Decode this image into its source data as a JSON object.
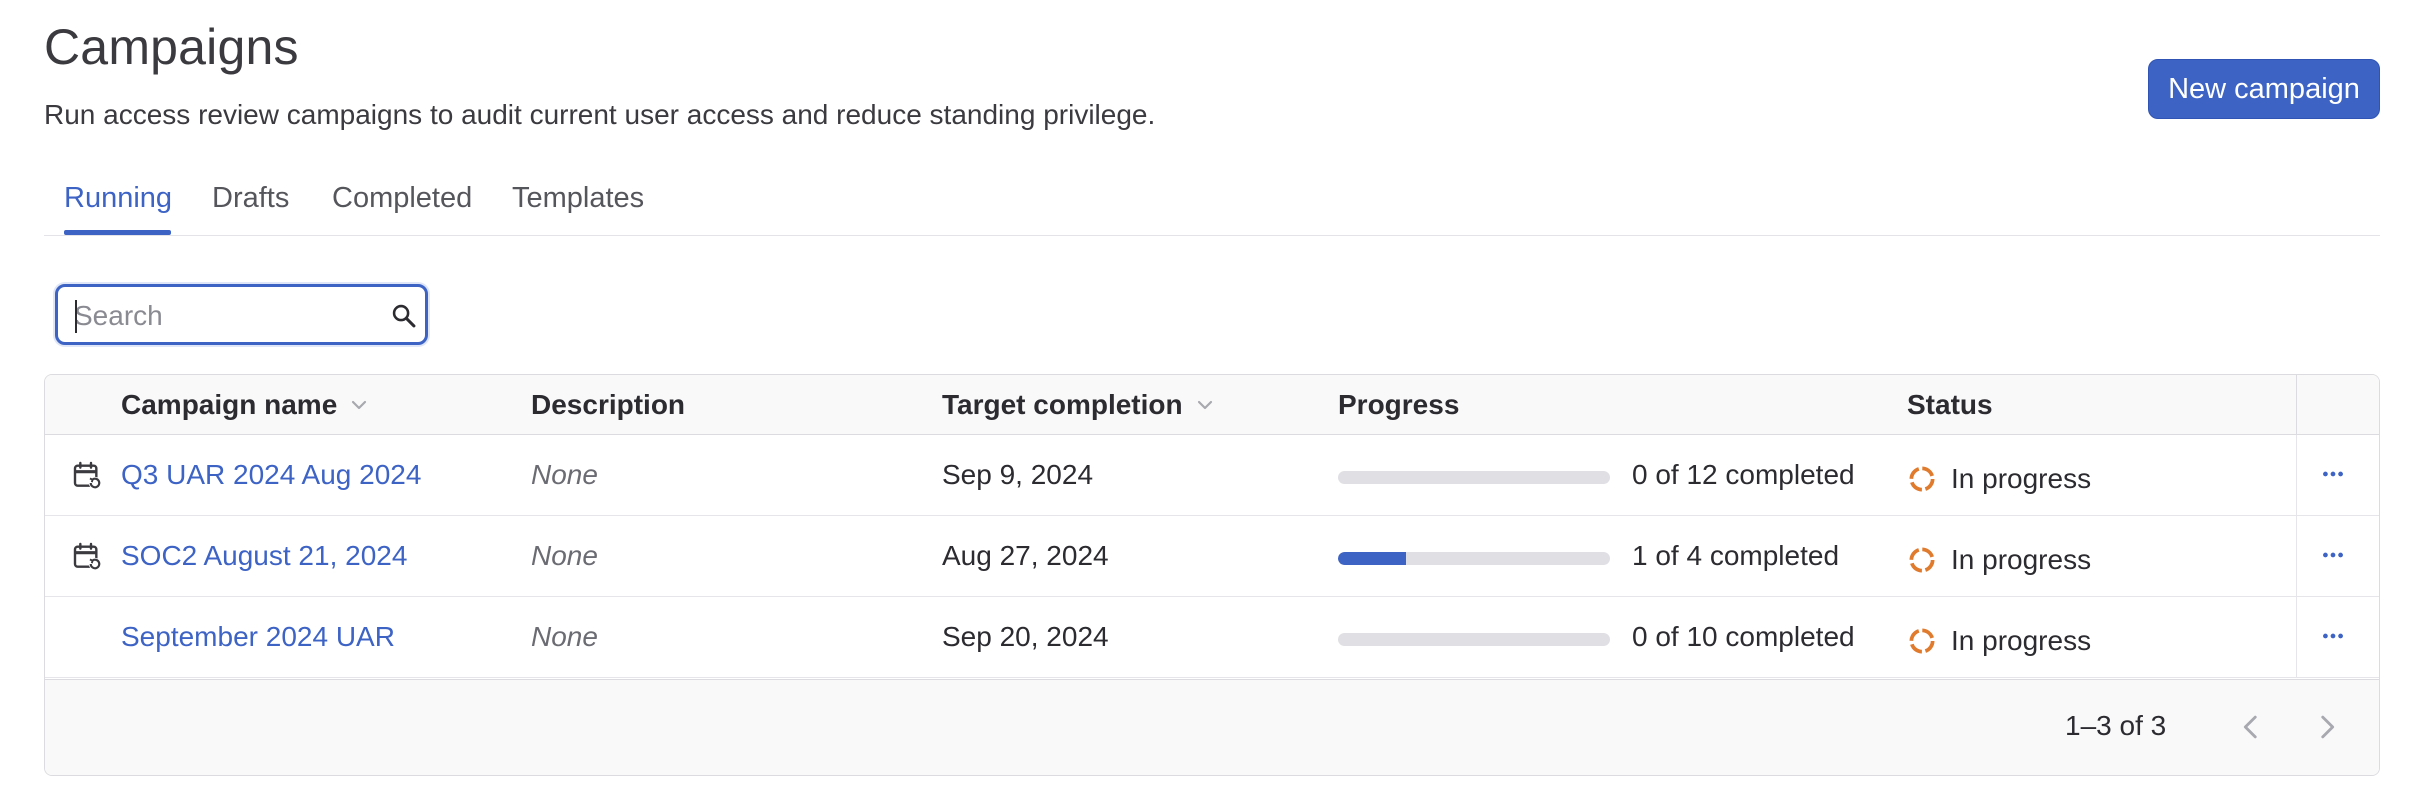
{
  "header": {
    "title": "Campaigns",
    "subtitle": "Run access review campaigns to audit current user access and reduce standing privilege.",
    "new_button_label": "New campaign"
  },
  "tabs": [
    {
      "label": "Running",
      "active": true
    },
    {
      "label": "Drafts",
      "active": false
    },
    {
      "label": "Completed",
      "active": false
    },
    {
      "label": "Templates",
      "active": false
    }
  ],
  "search": {
    "placeholder": "Search",
    "value": "",
    "icon": "search-icon"
  },
  "table": {
    "columns": [
      {
        "label": "Campaign name",
        "sortable": true
      },
      {
        "label": "Description",
        "sortable": false
      },
      {
        "label": "Target completion",
        "sortable": true
      },
      {
        "label": "Progress",
        "sortable": false
      },
      {
        "label": "Status",
        "sortable": false
      }
    ],
    "rows": [
      {
        "name": "Q3 UAR 2024 Aug 2024",
        "recurring": true,
        "description": "None",
        "target": "Sep 9, 2024",
        "progress_fraction": 0,
        "progress_text": "0 of 12 completed",
        "status": "In progress"
      },
      {
        "name": "SOC2 August 21, 2024",
        "recurring": true,
        "description": "None",
        "target": "Aug 27, 2024",
        "progress_fraction": 0.25,
        "progress_text": "1 of 4 completed",
        "status": "In progress"
      },
      {
        "name": "September 2024 UAR",
        "recurring": false,
        "description": "None",
        "target": "Sep 20, 2024",
        "progress_fraction": 0,
        "progress_text": "0 of 10 completed",
        "status": "In progress"
      }
    ],
    "pagination": {
      "range": "1–3 of 3"
    }
  },
  "colors": {
    "accent": "#3d63c5",
    "status_in_progress": "#e07b2e"
  }
}
